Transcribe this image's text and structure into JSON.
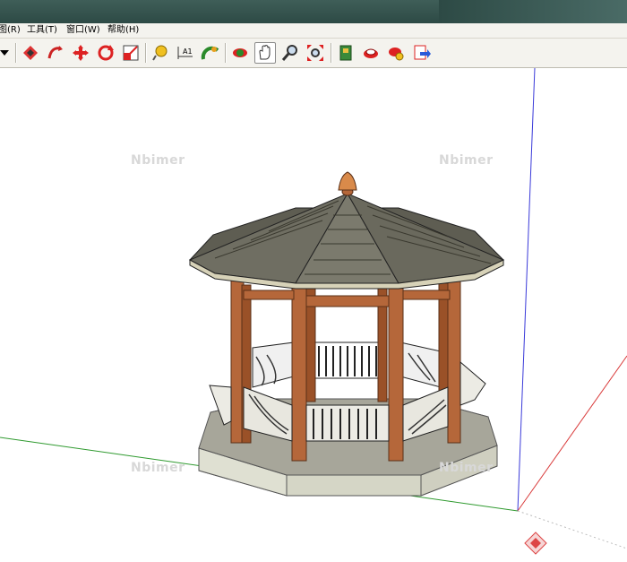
{
  "menu": {
    "items": [
      {
        "label": "图(R)"
      },
      {
        "label": "工具(T)"
      },
      {
        "label": "窗口(W)"
      },
      {
        "label": "帮助(H)"
      }
    ]
  },
  "toolbar": {
    "buttons": [
      {
        "icon": "dropdown-arrow-icon"
      },
      {
        "icon": "push-pull-icon"
      },
      {
        "icon": "follow-me-icon"
      },
      {
        "icon": "move-icon"
      },
      {
        "icon": "rotate-icon"
      },
      {
        "icon": "scale-icon"
      },
      {
        "icon": "tape-measure-icon"
      },
      {
        "icon": "dimension-icon"
      },
      {
        "icon": "protractor-icon"
      },
      {
        "icon": "orbit-icon"
      },
      {
        "icon": "pan-icon"
      },
      {
        "icon": "zoom-icon"
      },
      {
        "icon": "zoom-extents-icon"
      },
      {
        "icon": "components-icon"
      },
      {
        "icon": "get-models-icon"
      },
      {
        "icon": "share-model-icon"
      },
      {
        "icon": "export-icon"
      }
    ],
    "dimension_label": "A1"
  },
  "watermarks": [
    "Nbimer",
    "Nbimer",
    "Nbimer",
    "Nbimer"
  ],
  "colors": {
    "roof": "#6b6a5e",
    "post": "#b5673a",
    "base": "#bdbcb0",
    "axis_red": "#d93a3a",
    "axis_green": "#2f9a2f",
    "axis_blue": "#3a3ad9"
  }
}
